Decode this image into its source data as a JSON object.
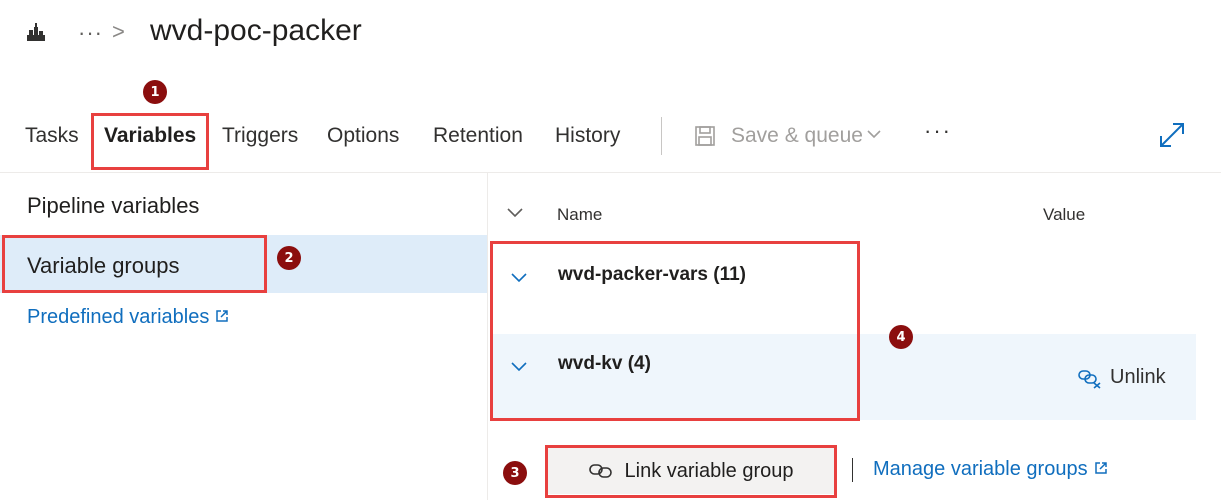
{
  "header": {
    "breadcrumb_more": "···",
    "breadcrumb_sep": ">",
    "title": "wvd-poc-packer"
  },
  "tabs": [
    {
      "label": "Tasks"
    },
    {
      "label": "Variables",
      "active": true
    },
    {
      "label": "Triggers"
    },
    {
      "label": "Options"
    },
    {
      "label": "Retention"
    },
    {
      "label": "History"
    }
  ],
  "toolbar": {
    "save_queue_label": "Save & queue",
    "more_label": "···",
    "icons": [
      "pipeline-icon",
      "save-icon",
      "chevron-down-icon",
      "expand-icon"
    ]
  },
  "left_nav": {
    "items": [
      {
        "label": "Pipeline variables"
      },
      {
        "label": "Variable groups",
        "selected": true
      }
    ],
    "predefined_link": "Predefined variables"
  },
  "table": {
    "col_name": "Name",
    "col_value": "Value",
    "groups": [
      {
        "name": "wvd-packer-vars (11)"
      },
      {
        "name": "wvd-kv (4)"
      }
    ],
    "unlink_label": "Unlink"
  },
  "actions": {
    "link_label": "Link variable group",
    "manage_label": "Manage variable groups"
  },
  "annotations": [
    "1",
    "2",
    "3",
    "4"
  ],
  "colors": {
    "accent": "#106ebe",
    "selected_bg": "#deecf9",
    "row_hover_bg": "#eff6fc",
    "highlight": "#e8403f",
    "badge": "#8b0e0e"
  }
}
